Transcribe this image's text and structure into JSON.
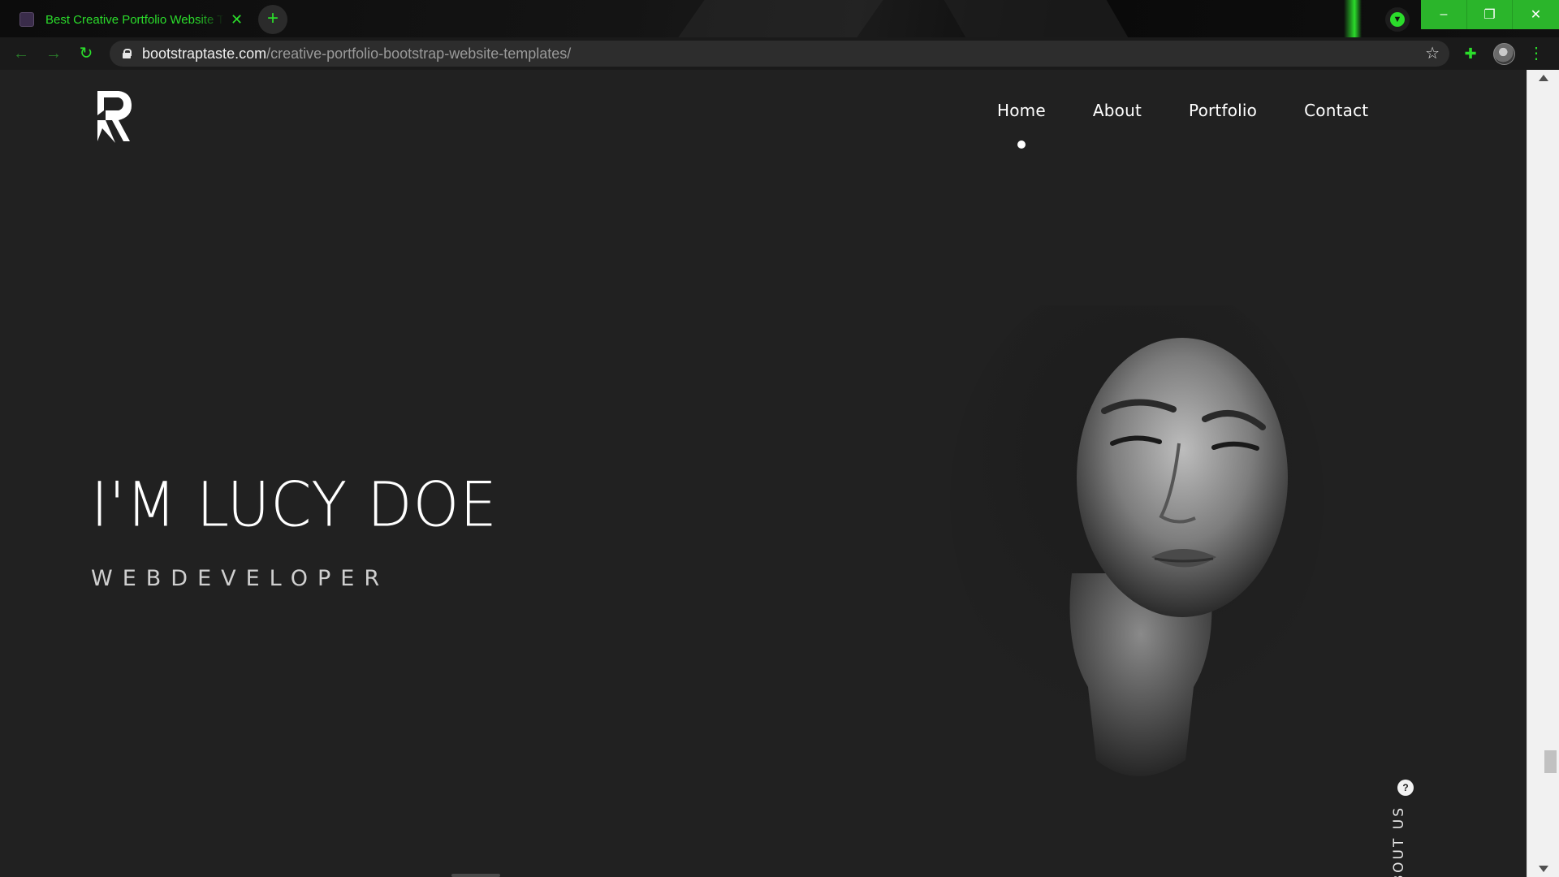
{
  "browser": {
    "tab": {
      "title": "Best Creative Portfolio Website Templates",
      "close_icon": "close-icon"
    },
    "new_tab_label": "+",
    "address": {
      "domain": "bootstraptaste.com",
      "path": "/creative-portfolio-bootstrap-website-templates/"
    },
    "window_controls": {
      "minimize": "–",
      "maximize": "❐",
      "close": "✕"
    },
    "nav_icons": {
      "back": "←",
      "forward": "→",
      "reload": "↻"
    },
    "toolbar_icons": {
      "star": "☆",
      "extensions": "✚",
      "menu": "⋮"
    },
    "accent_color": "#2bdc2b"
  },
  "site": {
    "nav": [
      {
        "label": "Home",
        "active": true
      },
      {
        "label": "About",
        "active": false
      },
      {
        "label": "Portfolio",
        "active": false
      },
      {
        "label": "Contact",
        "active": false
      }
    ],
    "hero": {
      "name": "I'M LUCY DOE",
      "role": "WEBDEVELOPER"
    },
    "side_link": {
      "text": "ABOUT US",
      "badge": "?"
    },
    "background": "#212121"
  }
}
